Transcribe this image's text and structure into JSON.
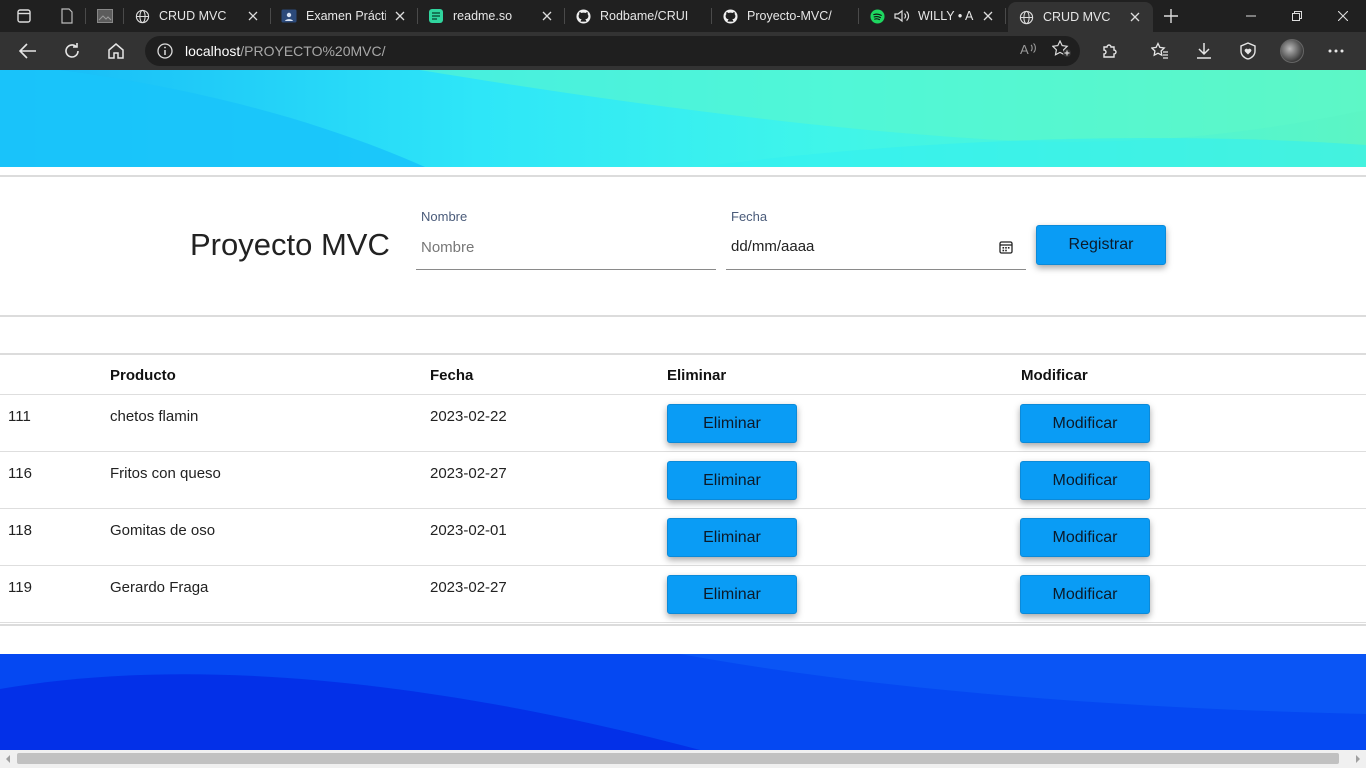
{
  "browser": {
    "tabs": [
      {
        "title": "",
        "icon": "page-icon"
      },
      {
        "title": "",
        "icon": "image-icon"
      },
      {
        "title": "CRUD MVC",
        "icon": "globe-icon"
      },
      {
        "title": "Examen Práctic",
        "icon": "classroom-icon"
      },
      {
        "title": "readme.so",
        "icon": "readme-icon"
      },
      {
        "title": "Rodbame/CRUI",
        "icon": "github-icon"
      },
      {
        "title": "Proyecto-MVC/",
        "icon": "github-icon"
      },
      {
        "title": "WILLY • Ar",
        "icon": "spotify-icon"
      },
      {
        "title": "CRUD MVC",
        "icon": "globe-icon"
      }
    ],
    "url_host": "localhost",
    "url_path": "/PROYECTO%20MVC/"
  },
  "app": {
    "title": "Proyecto MVC",
    "form": {
      "nombre_label": "Nombre",
      "nombre_placeholder": "Nombre",
      "fecha_label": "Fecha",
      "fecha_placeholder": "dd/mm/aaaa",
      "submit_label": "Registrar"
    },
    "table": {
      "headers": [
        "",
        "Producto",
        "Fecha",
        "Eliminar",
        "Modificar"
      ],
      "rows": [
        {
          "id": "111",
          "producto": "chetos flamin",
          "fecha": "2023-02-22",
          "eliminar": "Eliminar",
          "modificar": "Modificar"
        },
        {
          "id": "116",
          "producto": "Fritos con queso",
          "fecha": "2023-02-27",
          "eliminar": "Eliminar",
          "modificar": "Modificar"
        },
        {
          "id": "118",
          "producto": "Gomitas de oso",
          "fecha": "2023-02-01",
          "eliminar": "Eliminar",
          "modificar": "Modificar"
        },
        {
          "id": "119",
          "producto": "Gerardo Fraga",
          "fecha": "2023-02-27",
          "eliminar": "Eliminar",
          "modificar": "Modificar"
        }
      ]
    }
  },
  "colors": {
    "accent_button": "#0a9cf5",
    "top_wave_light": "#5cf5c4",
    "top_wave_cyan": "#2ee6f8",
    "bottom_wave_blue": "#0444f0",
    "chrome_dark": "#202020"
  }
}
